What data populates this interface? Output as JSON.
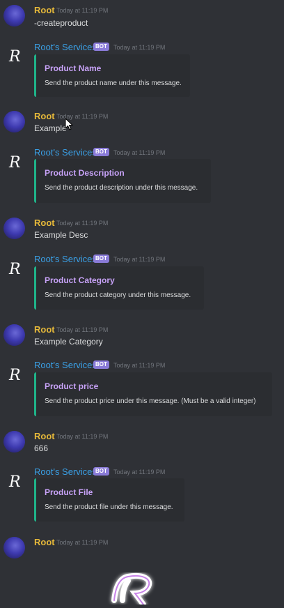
{
  "user_name": "Root",
  "bot_name": "Root's Services",
  "bot_badge": "BOT",
  "timestamp": "Today at 11:19 PM",
  "messages": [
    {
      "text": "-createproduct"
    },
    {
      "title": "Product Name",
      "desc": "Send the product name under this message."
    },
    {
      "text": "Example"
    },
    {
      "title": "Product Description",
      "desc": "Send the product description under this message."
    },
    {
      "text": "Example Desc"
    },
    {
      "title": "Product Category",
      "desc": "Send the product category under this message."
    },
    {
      "text": "Example Category"
    },
    {
      "title": "Product price",
      "desc": "Send the product price under this message. (Must be a valid integer)"
    },
    {
      "text": "666"
    },
    {
      "title": "Product File",
      "desc": "Send the product file under this message."
    },
    {
      "text": ""
    }
  ],
  "colors": {
    "background": "#2f3136",
    "user_name": "#e6b93a",
    "bot_name": "#3aa0e6",
    "embed_border": "#1fb389",
    "embed_title": "#c7a2f7",
    "badge": "#8a7bd8"
  },
  "icons": {
    "user_avatar": "avatar-icon",
    "bot_avatar": "r-logo-icon",
    "cursor": "cursor-icon"
  }
}
